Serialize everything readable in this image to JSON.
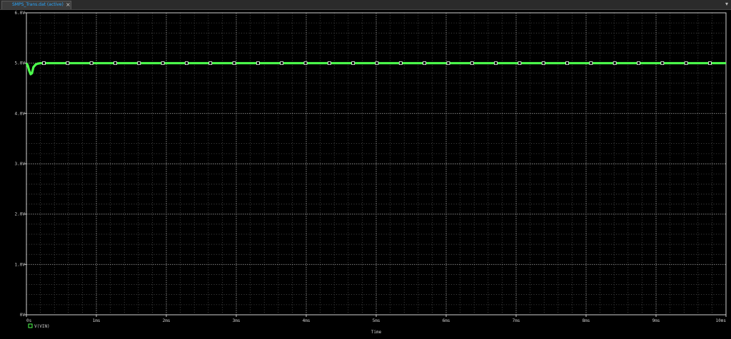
{
  "tab": {
    "title": "SMPS_Trans.dat (active)",
    "close": "×",
    "overflow": "▾"
  },
  "chart_data": {
    "type": "line",
    "xlabel": "Time",
    "ylabel": "",
    "xlim": [
      0,
      10
    ],
    "ylim": [
      0,
      6
    ],
    "x_ticks": [
      "0s",
      "1ms",
      "2ms",
      "3ms",
      "4ms",
      "5ms",
      "6ms",
      "7ms",
      "8ms",
      "9ms",
      "10ms"
    ],
    "y_ticks": [
      "0V",
      "1.0V",
      "2.0V",
      "3.0V",
      "4.0V",
      "5.0V",
      "6.0V"
    ],
    "grid": true,
    "legend": "bottom-left",
    "series": [
      {
        "name": "V(VIN)",
        "color": "#4cff4c",
        "x": [
          0,
          0.02,
          0.04,
          0.06,
          0.08,
          0.1,
          0.13,
          0.16,
          0.2,
          0.3,
          10
        ],
        "y": [
          5.0,
          4.95,
          4.85,
          4.78,
          4.8,
          4.92,
          4.97,
          4.99,
          5.0,
          5.0,
          5.0
        ],
        "marker_spacing": 0.34
      }
    ],
    "colors": {
      "background": "#000000",
      "grid": "#9a9a9a",
      "axis": "#cfcfcf"
    }
  }
}
